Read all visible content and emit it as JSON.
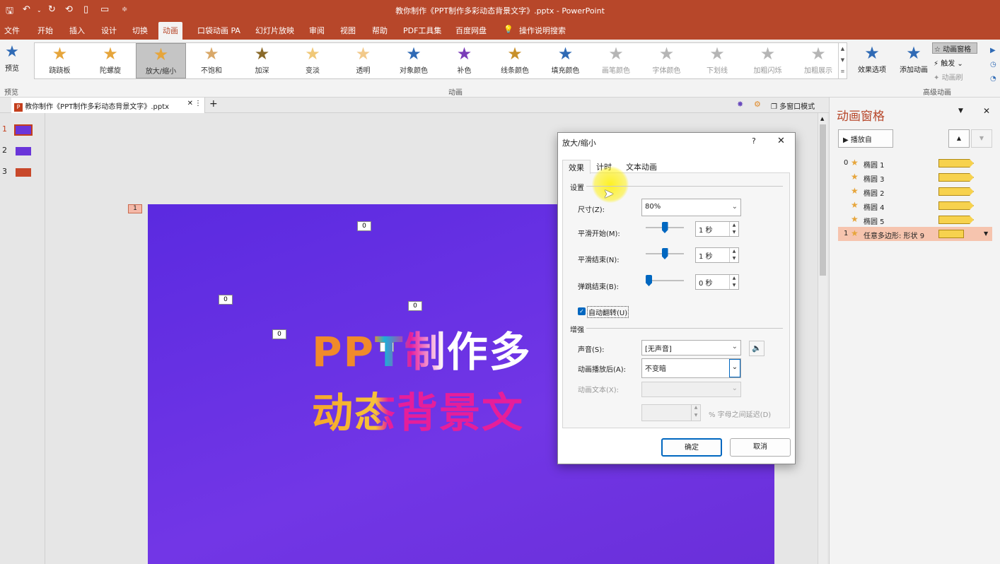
{
  "titlebar": {
    "title": "教你制作《PPT制作多彩动态背景文字》.pptx  -  PowerPoint",
    "quick_access": [
      "save-icon",
      "undo-icon",
      "redo-icon",
      "touch-mode-icon",
      "new-icon",
      "open-icon",
      "customize-icon"
    ]
  },
  "menu": [
    "文件",
    "开始",
    "插入",
    "设计",
    "切换",
    "动画",
    "口袋动画 PA",
    "幻灯片放映",
    "审阅",
    "视图",
    "帮助",
    "PDF工具集",
    "百度网盘",
    "操作说明搜索"
  ],
  "ribbon": {
    "preview_label": "预览",
    "preview_group": "预览",
    "animations": [
      {
        "label": "跷跷板",
        "color": "#e6a53b",
        "disabled": false
      },
      {
        "label": "陀螺旋",
        "color": "#e6a53b",
        "disabled": false
      },
      {
        "label": "放大/缩小",
        "color": "#e6a53b",
        "disabled": false,
        "selected": true
      },
      {
        "label": "不饱和",
        "color": "#d9a869",
        "disabled": false
      },
      {
        "label": "加深",
        "color": "#8a6a2a",
        "disabled": false
      },
      {
        "label": "变淡",
        "color": "#f0c878",
        "disabled": false
      },
      {
        "label": "透明",
        "color": "#f2c98a",
        "disabled": false
      },
      {
        "label": "对象颜色",
        "color": "#2f6ab5",
        "disabled": false
      },
      {
        "label": "补色",
        "color": "#7a3cb8",
        "disabled": false
      },
      {
        "label": "线条颜色",
        "color": "#c8902a",
        "disabled": false
      },
      {
        "label": "填充颜色",
        "color": "#2f6ab5",
        "disabled": false
      },
      {
        "label": "画笔颜色",
        "color": "#b5b5b5",
        "disabled": true
      },
      {
        "label": "字体颜色",
        "color": "#b5b5b5",
        "disabled": true
      },
      {
        "label": "下划线",
        "color": "#b5b5b5",
        "disabled": true
      },
      {
        "label": "加粗闪烁",
        "color": "#b5b5b5",
        "disabled": true
      },
      {
        "label": "加粗展示",
        "color": "#b5b5b5",
        "disabled": true
      }
    ],
    "group_animation": "动画",
    "effect_options": "效果选项",
    "add_animation": "添加动画",
    "animation_pane_btn": "动画窗格",
    "trigger_btn": "触发",
    "painter_btn": "动画刷",
    "group_advanced": "高级动画"
  },
  "doctab": {
    "name": "教你制作《PPT制作多彩动态背景文字》.pptx",
    "multi_window": "多窗口模式"
  },
  "thumbnails": [
    "1",
    "2",
    "3"
  ],
  "slide": {
    "badge": "1",
    "line1": "PPT制作多",
    "line2": "动态背景文",
    "zero": "0"
  },
  "pane": {
    "title": "动画窗格",
    "play_from": "播放自",
    "items": [
      {
        "num": "0",
        "name": "椭圆 1"
      },
      {
        "num": "",
        "name": "椭圆 3"
      },
      {
        "num": "",
        "name": "椭圆 2"
      },
      {
        "num": "",
        "name": "椭圆 4"
      },
      {
        "num": "",
        "name": "椭圆 5"
      },
      {
        "num": "1",
        "name": "任意多边形: 形状 9",
        "selected": true
      }
    ]
  },
  "dialog": {
    "title": "放大/缩小",
    "help": "?",
    "close": "✕",
    "tabs": [
      "效果",
      "计时",
      "文本动画"
    ],
    "section_settings": "设置",
    "size_label": "尺寸(Z):",
    "size_value": "80%",
    "smooth_start_label": "平滑开始(M):",
    "smooth_start_value": "1 秒",
    "smooth_start_level": 0.5,
    "smooth_end_label": "平滑结束(N):",
    "smooth_end_value": "1 秒",
    "smooth_end_level": 0.5,
    "bounce_end_label": "弹跳结束(B):",
    "bounce_end_value": "0 秒",
    "bounce_end_level": 0.0,
    "auto_reverse_label": "自动翻转(U)",
    "auto_reverse_checked": true,
    "section_enhance": "增强",
    "sound_label": "声音(S):",
    "sound_value": "[无声音]",
    "after_label": "动画播放后(A):",
    "after_value": "不变暗",
    "text_anim_label": "动画文本(X):",
    "text_anim_value": "",
    "letter_delay_suffix": "% 字母之间延迟(D)",
    "ok": "确定",
    "cancel": "取消"
  }
}
